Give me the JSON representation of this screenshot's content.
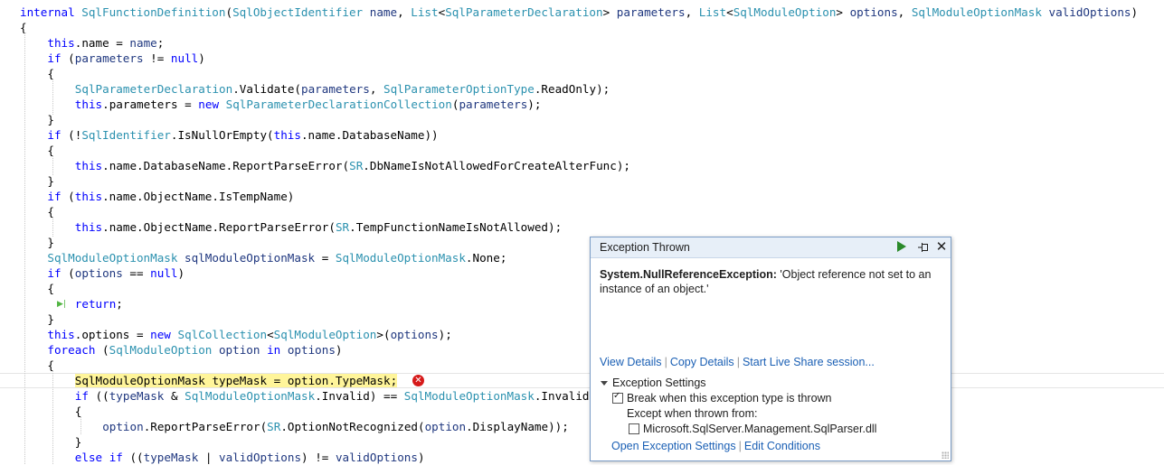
{
  "code": {
    "lines": [
      {
        "indent": "",
        "tokens": [
          [
            "k",
            "internal "
          ],
          [
            "t",
            "SqlFunctionDefinition"
          ],
          [
            "n",
            "("
          ],
          [
            "t",
            "SqlObjectIdentifier"
          ],
          [
            "n",
            " "
          ],
          [
            "p",
            "name"
          ],
          [
            "n",
            ", "
          ],
          [
            "t",
            "List"
          ],
          [
            "n",
            "<"
          ],
          [
            "t",
            "SqlParameterDeclaration"
          ],
          [
            "n",
            "> "
          ],
          [
            "p",
            "parameters"
          ],
          [
            "n",
            ", "
          ],
          [
            "t",
            "List"
          ],
          [
            "n",
            "<"
          ],
          [
            "t",
            "SqlModuleOption"
          ],
          [
            "n",
            "> "
          ],
          [
            "p",
            "options"
          ],
          [
            "n",
            ", "
          ],
          [
            "t",
            "SqlModuleOptionMask"
          ],
          [
            "n",
            " "
          ],
          [
            "p",
            "validOptions"
          ],
          [
            "n",
            ")"
          ]
        ]
      },
      {
        "indent": "",
        "tokens": [
          [
            "n",
            "{"
          ]
        ]
      },
      {
        "indent": "    ",
        "tokens": [
          [
            "k",
            "this"
          ],
          [
            "n",
            ".name = "
          ],
          [
            "p",
            "name"
          ],
          [
            "n",
            ";"
          ]
        ]
      },
      {
        "indent": "    ",
        "tokens": [
          [
            "k",
            "if"
          ],
          [
            "n",
            " ("
          ],
          [
            "p",
            "parameters"
          ],
          [
            "n",
            " != "
          ],
          [
            "k",
            "null"
          ],
          [
            "n",
            ")"
          ]
        ]
      },
      {
        "indent": "    ",
        "tokens": [
          [
            "n",
            "{"
          ]
        ]
      },
      {
        "indent": "        ",
        "tokens": [
          [
            "t",
            "SqlParameterDeclaration"
          ],
          [
            "n",
            ".Validate("
          ],
          [
            "p",
            "parameters"
          ],
          [
            "n",
            ", "
          ],
          [
            "t",
            "SqlParameterOptionType"
          ],
          [
            "n",
            ".ReadOnly);"
          ]
        ]
      },
      {
        "indent": "        ",
        "tokens": [
          [
            "k",
            "this"
          ],
          [
            "n",
            ".parameters = "
          ],
          [
            "k",
            "new"
          ],
          [
            "n",
            " "
          ],
          [
            "t",
            "SqlParameterDeclarationCollection"
          ],
          [
            "n",
            "("
          ],
          [
            "p",
            "parameters"
          ],
          [
            "n",
            ");"
          ]
        ]
      },
      {
        "indent": "    ",
        "tokens": [
          [
            "n",
            "}"
          ]
        ]
      },
      {
        "indent": "    ",
        "tokens": [
          [
            "k",
            "if"
          ],
          [
            "n",
            " (!"
          ],
          [
            "t",
            "SqlIdentifier"
          ],
          [
            "n",
            ".IsNullOrEmpty("
          ],
          [
            "k",
            "this"
          ],
          [
            "n",
            ".name.DatabaseName))"
          ]
        ]
      },
      {
        "indent": "    ",
        "tokens": [
          [
            "n",
            "{"
          ]
        ]
      },
      {
        "indent": "        ",
        "tokens": [
          [
            "k",
            "this"
          ],
          [
            "n",
            ".name.DatabaseName.ReportParseError("
          ],
          [
            "t",
            "SR"
          ],
          [
            "n",
            ".DbNameIsNotAllowedForCreateAlterFunc);"
          ]
        ]
      },
      {
        "indent": "    ",
        "tokens": [
          [
            "n",
            "}"
          ]
        ]
      },
      {
        "indent": "    ",
        "tokens": [
          [
            "k",
            "if"
          ],
          [
            "n",
            " ("
          ],
          [
            "k",
            "this"
          ],
          [
            "n",
            ".name.ObjectName.IsTempName)"
          ]
        ]
      },
      {
        "indent": "    ",
        "tokens": [
          [
            "n",
            "{"
          ]
        ]
      },
      {
        "indent": "        ",
        "tokens": [
          [
            "k",
            "this"
          ],
          [
            "n",
            ".name.ObjectName.ReportParseError("
          ],
          [
            "t",
            "SR"
          ],
          [
            "n",
            ".TempFunctionNameIsNotAllowed);"
          ]
        ]
      },
      {
        "indent": "    ",
        "tokens": [
          [
            "n",
            "}"
          ]
        ]
      },
      {
        "indent": "    ",
        "tokens": [
          [
            "t",
            "SqlModuleOptionMask"
          ],
          [
            "n",
            " "
          ],
          [
            "p",
            "sqlModuleOptionMask"
          ],
          [
            "n",
            " = "
          ],
          [
            "t",
            "SqlModuleOptionMask"
          ],
          [
            "n",
            ".None;"
          ]
        ]
      },
      {
        "indent": "    ",
        "tokens": [
          [
            "k",
            "if"
          ],
          [
            "n",
            " ("
          ],
          [
            "p",
            "options"
          ],
          [
            "n",
            " == "
          ],
          [
            "k",
            "null"
          ],
          [
            "n",
            ")"
          ]
        ]
      },
      {
        "indent": "    ",
        "tokens": [
          [
            "n",
            "{"
          ]
        ]
      },
      {
        "indent": "        ",
        "tokens": [
          [
            "k",
            "return"
          ],
          [
            "n",
            ";"
          ]
        ]
      },
      {
        "indent": "    ",
        "tokens": [
          [
            "n",
            "}"
          ]
        ]
      },
      {
        "indent": "    ",
        "tokens": [
          [
            "k",
            "this"
          ],
          [
            "n",
            ".options = "
          ],
          [
            "k",
            "new"
          ],
          [
            "n",
            " "
          ],
          [
            "t",
            "SqlCollection"
          ],
          [
            "n",
            "<"
          ],
          [
            "t",
            "SqlModuleOption"
          ],
          [
            "n",
            ">("
          ],
          [
            "p",
            "options"
          ],
          [
            "n",
            ");"
          ]
        ]
      },
      {
        "indent": "    ",
        "tokens": [
          [
            "k",
            "foreach"
          ],
          [
            "n",
            " ("
          ],
          [
            "t",
            "SqlModuleOption"
          ],
          [
            "n",
            " "
          ],
          [
            "p",
            "option"
          ],
          [
            "n",
            " "
          ],
          [
            "k",
            "in"
          ],
          [
            "n",
            " "
          ],
          [
            "p",
            "options"
          ],
          [
            "n",
            ")"
          ]
        ]
      },
      {
        "indent": "    ",
        "tokens": [
          [
            "n",
            "{"
          ]
        ]
      },
      {
        "indent": "        ",
        "current": true,
        "tokens": [
          [
            "hl",
            "SqlModuleOptionMask typeMask = option.TypeMask;"
          ]
        ]
      },
      {
        "indent": "        ",
        "tokens": [
          [
            "k",
            "if"
          ],
          [
            "n",
            " (("
          ],
          [
            "p",
            "typeMask"
          ],
          [
            "n",
            " & "
          ],
          [
            "t",
            "SqlModuleOptionMask"
          ],
          [
            "n",
            ".Invalid) == "
          ],
          [
            "t",
            "SqlModuleOptionMask"
          ],
          [
            "n",
            ".Invalid"
          ]
        ]
      },
      {
        "indent": "        ",
        "tokens": [
          [
            "n",
            "{"
          ]
        ]
      },
      {
        "indent": "            ",
        "tokens": [
          [
            "p",
            "option"
          ],
          [
            "n",
            ".ReportParseError("
          ],
          [
            "t",
            "SR"
          ],
          [
            "n",
            ".OptionNotRecognized("
          ],
          [
            "p",
            "option"
          ],
          [
            "n",
            ".DisplayName));"
          ]
        ]
      },
      {
        "indent": "        ",
        "tokens": [
          [
            "n",
            "}"
          ]
        ]
      },
      {
        "indent": "        ",
        "tokens": [
          [
            "k",
            "else if"
          ],
          [
            "n",
            " (("
          ],
          [
            "p",
            "typeMask"
          ],
          [
            "n",
            " | "
          ],
          [
            "p",
            "validOptions"
          ],
          [
            "n",
            ") != "
          ],
          [
            "p",
            "validOptions"
          ],
          [
            "n",
            ")"
          ]
        ]
      }
    ]
  },
  "popup": {
    "title": "Exception Thrown",
    "exception_type": "System.NullReferenceException:",
    "exception_message": " 'Object reference not set to an instance of an object.'",
    "links": [
      "View Details",
      "Copy Details",
      "Start Live Share session..."
    ],
    "settings_header": "Exception Settings",
    "break_label": "Break when this exception type is thrown",
    "break_checked": true,
    "except_label": "Except when thrown from:",
    "module_label": "Microsoft.SqlServer.Management.SqlParser.dll",
    "module_checked": false,
    "bottom_links": [
      "Open Exception Settings",
      "Edit Conditions"
    ],
    "close_glyph": "✕"
  }
}
